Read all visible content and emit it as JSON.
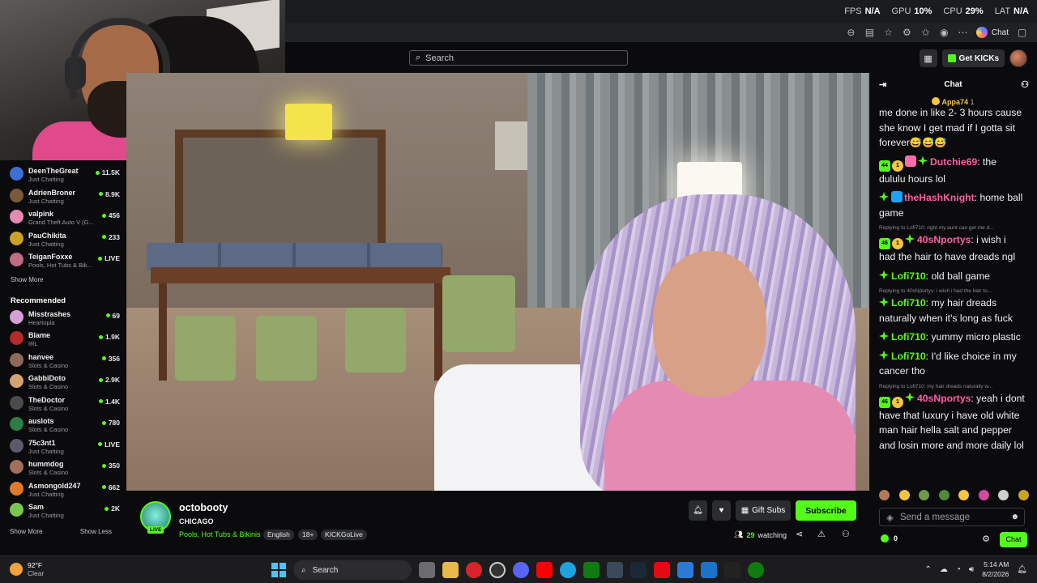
{
  "perf": {
    "fps_label": "FPS",
    "fps_value": "N/A",
    "gpu_label": "GPU",
    "gpu_value": "10%",
    "cpu_label": "CPU",
    "cpu_value": "29%",
    "lat_label": "LAT",
    "lat_value": "N/A"
  },
  "browser": {
    "chat_label": "Chat"
  },
  "header": {
    "search_placeholder": "Search",
    "get_kicks_label": "Get KICKs"
  },
  "sidebar": {
    "following": [
      {
        "name": "DeenTheGreat",
        "category": "Just Chatting",
        "viewers": "11.5K",
        "color": "#3b6fd1"
      },
      {
        "name": "AdrienBroner",
        "category": "Just Chatting",
        "viewers": "8.9K",
        "color": "#7a5a3a"
      },
      {
        "name": "valpink",
        "category": "Grand Theft Auto V (G...",
        "viewers": "456",
        "color": "#e58bb3"
      },
      {
        "name": "PauChikita",
        "category": "Just Chatting",
        "viewers": "233",
        "color": "#c9a227"
      },
      {
        "name": "TeiganFoxxe",
        "category": "Pools, Hot Tubs & Bik...",
        "viewers": "LIVE",
        "color": "#c06c84"
      }
    ],
    "show_more": "Show More",
    "recommended_title": "Recommended",
    "recommended": [
      {
        "name": "Misstrashes",
        "category": "Heartopia",
        "viewers": "69",
        "color": "#d6a0d6"
      },
      {
        "name": "Blame",
        "category": "IRL",
        "viewers": "1.9K",
        "color": "#b52a2a"
      },
      {
        "name": "hanvee",
        "category": "Slots & Casino",
        "viewers": "356",
        "color": "#8f6a5a"
      },
      {
        "name": "GabbiDoto",
        "category": "Slots & Casino",
        "viewers": "2.9K",
        "color": "#d4a373"
      },
      {
        "name": "TheDoctor",
        "category": "Slots & Casino",
        "viewers": "1.4K",
        "color": "#4b4b4b"
      },
      {
        "name": "auslots",
        "category": "Slots & Casino",
        "viewers": "780",
        "color": "#2d7d46"
      },
      {
        "name": "75c3nt1",
        "category": "Just Chatting",
        "viewers": "LIVE",
        "color": "#5a5a6a"
      },
      {
        "name": "hummdog",
        "category": "Slots & Casino",
        "viewers": "350",
        "color": "#a0705a"
      },
      {
        "name": "Asmongold247",
        "category": "Just Chatting",
        "viewers": "662",
        "color": "#e07a2a"
      },
      {
        "name": "Sam",
        "category": "Just Chatting",
        "viewers": "2K",
        "color": "#7ac74f"
      }
    ],
    "show_more_2": "Show More",
    "show_less": "Show Less"
  },
  "stream": {
    "channel": "octobooty",
    "live_tag": "LIVE",
    "title": "CHICAGO",
    "category": "Pools, Hot Tubs & Bikinis",
    "tags": [
      "English",
      "18+",
      "KICKGoLive"
    ],
    "gift_subs": "Gift Subs",
    "subscribe": "Subscribe",
    "watching_count": "29",
    "watching_label": "watching"
  },
  "chat": {
    "title": "Chat",
    "pinned_user": "Appa74",
    "pinned_count": "1",
    "messages": [
      {
        "reply": "",
        "user": "",
        "color": "#fff",
        "text": "me done in like 2- 3 hours cause she know I get mad if I gotta sit forever😅😅😅"
      },
      {
        "reply": "",
        "user": "Dutchie69",
        "color": "#ff5fa2",
        "text": ": the dululu hours lol",
        "badges": [
          "44",
          "1",
          "g",
          "s"
        ]
      },
      {
        "reply": "",
        "user": "theHashKnight",
        "color": "#ff5fa2",
        "text": ": home ball game",
        "badges": [
          "s",
          "b"
        ]
      },
      {
        "reply": "Replying to Lofi710: right my aunt can get me d...",
        "user": "40sNportys",
        "color": "#ff5fa2",
        "text": ": i wish i had the hair to have dreads ngl",
        "badges": [
          "46",
          "1",
          "s"
        ]
      },
      {
        "reply": "",
        "user": "Lofi710",
        "color": "#53fc18",
        "text": ": old ball game",
        "badges": [
          "s"
        ]
      },
      {
        "reply": "Replying to 40sNportys: i wish i had the hair to...",
        "user": "Lofi710",
        "color": "#53fc18",
        "text": ": my hair dreads naturally when it's long as fuck",
        "badges": [
          "s"
        ]
      },
      {
        "reply": "",
        "user": "Lofi710",
        "color": "#53fc18",
        "text": ": yummy micro plastic",
        "badges": [
          "s"
        ]
      },
      {
        "reply": "",
        "user": "Lofi710",
        "color": "#53fc18",
        "text": ": I'd like choice in my cancer tho",
        "badges": [
          "s"
        ]
      },
      {
        "reply": "Replying to Lofi710: my hair dreads naturally w...",
        "user": "40sNportys",
        "color": "#ff5fa2",
        "text": ": yeah i dont have that luxury i have old white man hair hella salt and pepper and losin more and more daily lol",
        "badges": [
          "46",
          "1",
          "s"
        ]
      }
    ],
    "send_placeholder": "Send a message",
    "points": "0",
    "chat_button": "Chat"
  },
  "taskbar": {
    "temp": "92°F",
    "condition": "Clear",
    "search": "Search",
    "time": "5:14 AM",
    "date": "8/2/2026"
  }
}
